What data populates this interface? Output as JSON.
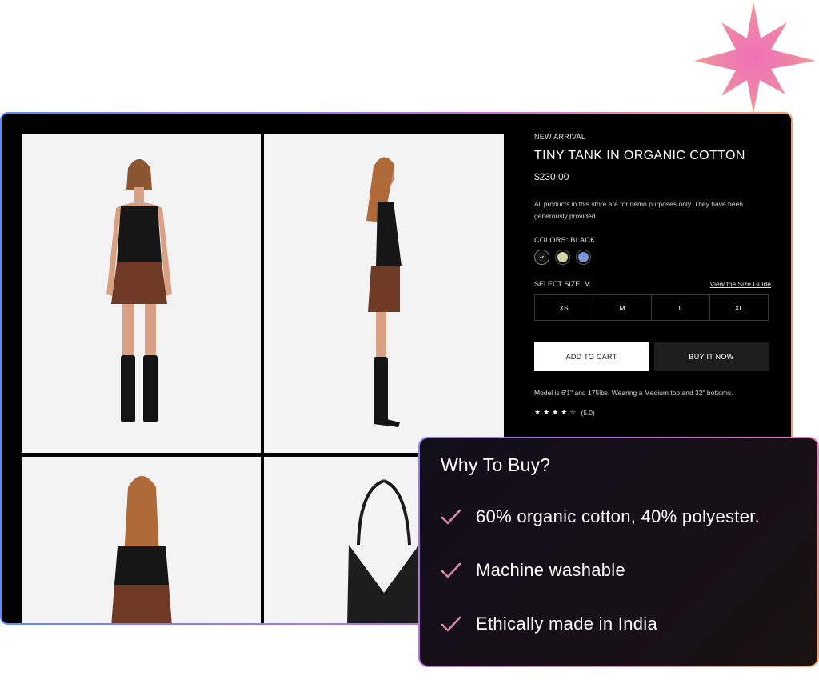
{
  "product": {
    "badge": "NEW ARRIVAL",
    "title": "TINY TANK IN ORGANIC COTTON",
    "price": "$230.00",
    "notice": "All products in this store are for demo purposes only. They have been generously provided",
    "colors_label": "COLORS: BLACK",
    "swatches": [
      {
        "name": "black",
        "color": "#1a1a1a"
      },
      {
        "name": "sage",
        "color": "#d9d4a4"
      },
      {
        "name": "blue",
        "color": "#7d95d6"
      }
    ],
    "size_label": "SELECT SIZE: M",
    "size_guide": "View the Size Guide",
    "sizes": [
      "XS",
      "M",
      "L",
      "XL"
    ],
    "add_to_cart": "ADD TO CART",
    "buy_now": "BUY IT NOW",
    "model_info": "Model is 6'1\" and 175lbs. Wearing a Medium top and 32\" bottoms.",
    "rating": "(5.0)",
    "rating_value": 4.5
  },
  "why": {
    "title": "Why To Buy?",
    "items": [
      "60% organic cotton, 40%  polyester.",
      "Machine washable",
      "Ethically made in India"
    ]
  },
  "colors": {
    "accent_gradient_start": "#5b8cff",
    "accent_gradient_end": "#f6a06a",
    "check": "#e98bb8"
  }
}
